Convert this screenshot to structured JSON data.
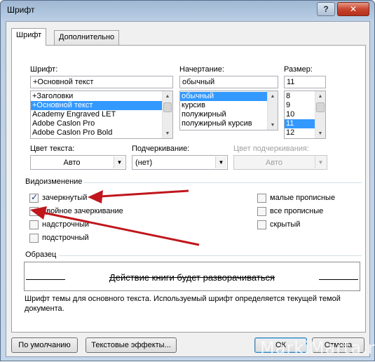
{
  "window": {
    "title": "Шрифт",
    "help_label": "?",
    "close_label": "✕"
  },
  "tabs": [
    {
      "label": "Шрифт",
      "active": true
    },
    {
      "label": "Дополнительно",
      "active": false
    }
  ],
  "font": {
    "label": "Шрифт:",
    "value": "+Основной текст",
    "items": [
      "+Заголовки",
      "+Основной текст",
      "Academy Engraved LET",
      "Adobe Caslon Pro",
      "Adobe Caslon Pro Bold"
    ],
    "selected_index": 1
  },
  "style": {
    "label": "Начертание:",
    "value": "обычный",
    "items": [
      "обычный",
      "курсив",
      "полужирный",
      "полужирный курсив"
    ],
    "selected_index": 0
  },
  "size": {
    "label": "Размер:",
    "value": "11",
    "items": [
      "8",
      "9",
      "10",
      "11",
      "12"
    ],
    "selected_index": 3
  },
  "font_color": {
    "label": "Цвет текста:",
    "value": "Авто"
  },
  "underline": {
    "label": "Подчеркивание:",
    "value": "(нет)"
  },
  "underline_color": {
    "label": "Цвет подчеркивания:",
    "value": "Авто"
  },
  "effects": {
    "title": "Видоизменение",
    "left": [
      {
        "label": "зачеркнутый",
        "checked": true
      },
      {
        "label": "двойное зачеркивание",
        "checked": false
      },
      {
        "label": "надстрочный",
        "checked": false
      },
      {
        "label": "подстрочный",
        "checked": false
      }
    ],
    "right": [
      {
        "label": "малые прописные",
        "checked": false
      },
      {
        "label": "все прописные",
        "checked": false
      },
      {
        "label": "скрытый",
        "checked": false
      }
    ]
  },
  "preview": {
    "title": "Образец",
    "text": "Действие книги будет разворачиваться",
    "description": "Шрифт темы для основного текста. Используемый шрифт определяется текущей темой документа."
  },
  "buttons": {
    "default": "По умолчанию",
    "text_effects": "Текстовые эффекты...",
    "ok": "ОК",
    "cancel": "Отмена"
  },
  "watermark": "MarkiMarta.ru",
  "colors": {
    "selection": "#3399ff",
    "annotation_arrow": "#c0161c",
    "titlebar": "#bcd0e6"
  }
}
